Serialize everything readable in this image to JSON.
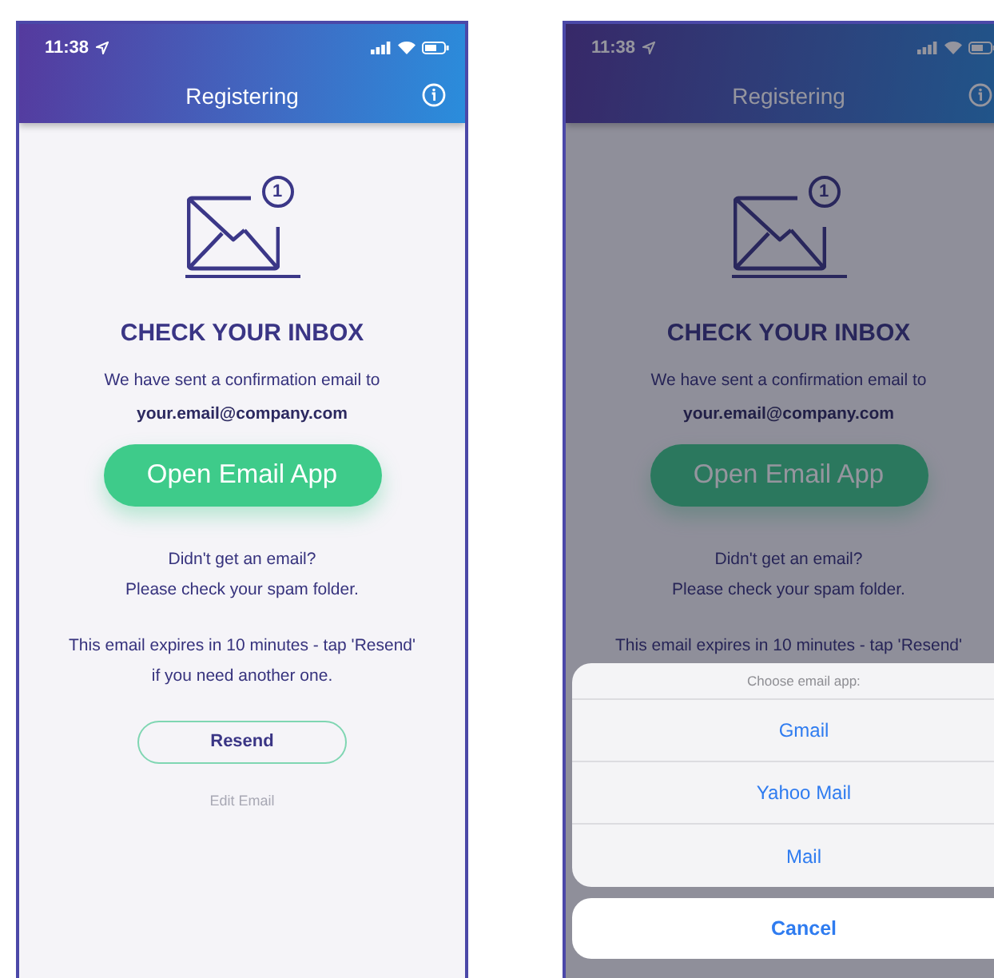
{
  "screens": [
    {
      "status_bar": {
        "time": "11:38"
      },
      "header": {
        "title": "Registering"
      },
      "badge": "1",
      "heading": "CHECK YOUR INBOX",
      "message": "We have sent a confirmation email to",
      "email": "your.email@company.com",
      "primary_button": "Open Email App",
      "help_lines": [
        "Didn't get an email?",
        "Please check your spam folder."
      ],
      "expiry_lines": [
        "This email expires in 10 minutes - tap 'Resend'",
        "if you need another one."
      ],
      "resend_button": "Resend",
      "edit_link": "Edit Email",
      "dimmed": false
    },
    {
      "status_bar": {
        "time": "11:38"
      },
      "header": {
        "title": "Registering"
      },
      "badge": "1",
      "heading": "CHECK YOUR INBOX",
      "message": "We have sent a confirmation email to",
      "email": "your.email@company.com",
      "primary_button": "Open Email App",
      "help_lines": [
        "Didn't get an email?",
        "Please check your spam folder."
      ],
      "expiry_lines": [
        "This email expires in 10 minutes - tap 'Resend'"
      ],
      "dimmed": true,
      "action_sheet": {
        "title": "Choose email app:",
        "options": [
          "Gmail",
          "Yahoo Mail",
          "Mail"
        ],
        "cancel": "Cancel"
      }
    }
  ]
}
